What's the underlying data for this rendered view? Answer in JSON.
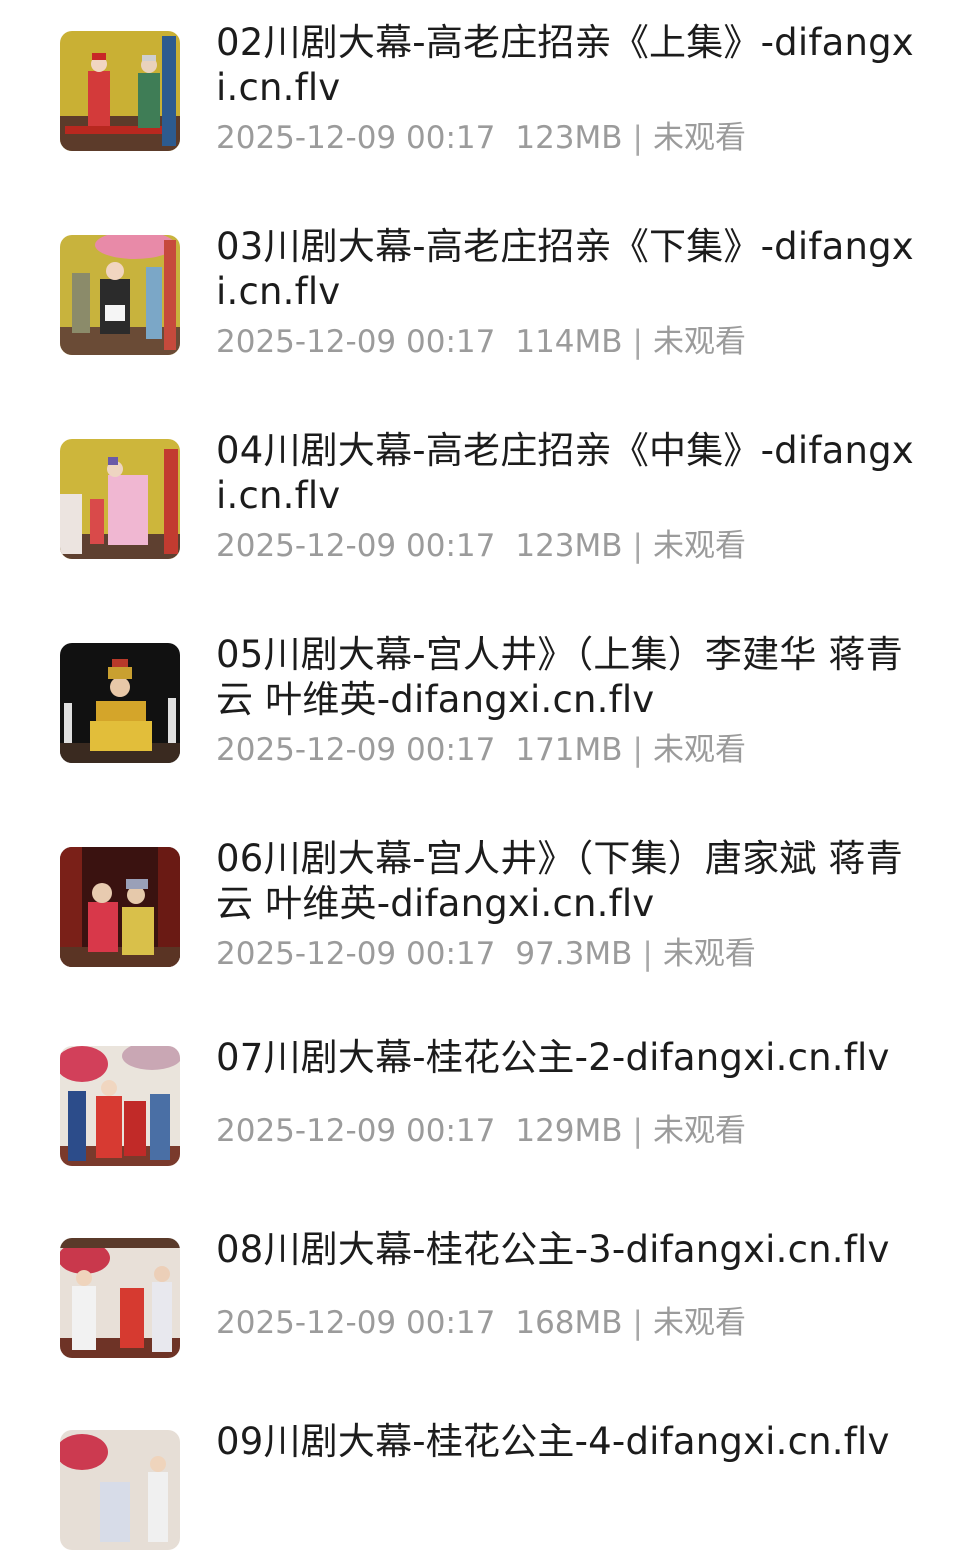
{
  "files": [
    {
      "title": "02川剧大幕-高老庄招亲《上集》-difangxi.cn.flv",
      "date": "2025-12-09 00:17",
      "size": "123MB",
      "status": "未观看",
      "thumb": "yellow-stage"
    },
    {
      "title": "03川剧大幕-高老庄招亲《下集》-difangxi.cn.flv",
      "date": "2025-12-09 00:17",
      "size": "114MB",
      "status": "未观看",
      "thumb": "yellow-stage"
    },
    {
      "title": "04川剧大幕-高老庄招亲《中集》-difangxi.cn.flv",
      "date": "2025-12-09 00:17",
      "size": "123MB",
      "status": "未观看",
      "thumb": "yellow-stage"
    },
    {
      "title": "05川剧大幕-宫人井》（上集）李建华 蒋青云 叶维英-difangxi.cn.flv",
      "date": "2025-12-09 00:17",
      "size": "171MB",
      "status": "未观看",
      "thumb": "dark-stage"
    },
    {
      "title": "06川剧大幕-宫人井》（下集）唐家斌 蒋青云 叶维英-difangxi.cn.flv",
      "date": "2025-12-09 00:17",
      "size": "97.3MB",
      "status": "未观看",
      "thumb": "dark-stage"
    },
    {
      "title": "07川剧大幕-桂花公主-2-difangxi.cn.flv",
      "date": "2025-12-09 00:17",
      "size": "129MB",
      "status": "未观看",
      "thumb": "flower-stage"
    },
    {
      "title": "08川剧大幕-桂花公主-3-difangxi.cn.flv",
      "date": "2025-12-09 00:17",
      "size": "168MB",
      "status": "未观看",
      "thumb": "flower-stage"
    },
    {
      "title": "09川剧大幕-桂花公主-4-difangxi.cn.flv",
      "date": "",
      "size": "",
      "status": "",
      "thumb": "flower-stage"
    }
  ],
  "colors": {
    "title": "#1c1c1c",
    "meta": "#9b9b9b",
    "background": "#ffffff"
  }
}
